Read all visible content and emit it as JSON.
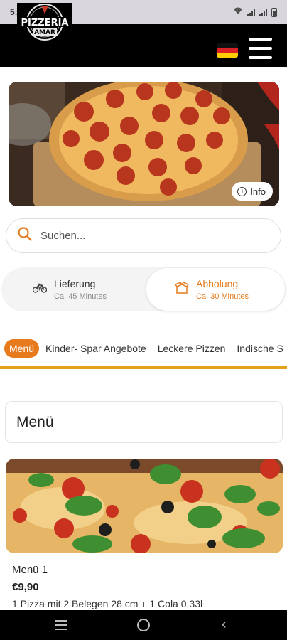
{
  "status_bar": {
    "time": "5:39"
  },
  "header": {
    "logo_text": "PIZZERIA AMAR",
    "language": "de"
  },
  "hero": {
    "info_label": "Info"
  },
  "search": {
    "placeholder": "Suchen..."
  },
  "delivery": {
    "options": [
      {
        "label": "Lieferung",
        "time": "Ca. 45 Minutes",
        "selected": false
      },
      {
        "label": "Abholung",
        "time": "Ca. 30 Minutes",
        "selected": true
      }
    ]
  },
  "categories": [
    "Menü",
    "Kinder- Spar Angebote",
    "Leckere Pizzen",
    "Indische S"
  ],
  "section": {
    "title": "Menü"
  },
  "product": {
    "name": "Menü 1",
    "price": "€9,90",
    "description": "1 Pizza mit 2 Belegen 28 cm + 1 Cola 0,33l"
  },
  "colors": {
    "accent": "#e67a1d",
    "tab_underline": "#e2a21a",
    "header_bg": "#000000"
  }
}
